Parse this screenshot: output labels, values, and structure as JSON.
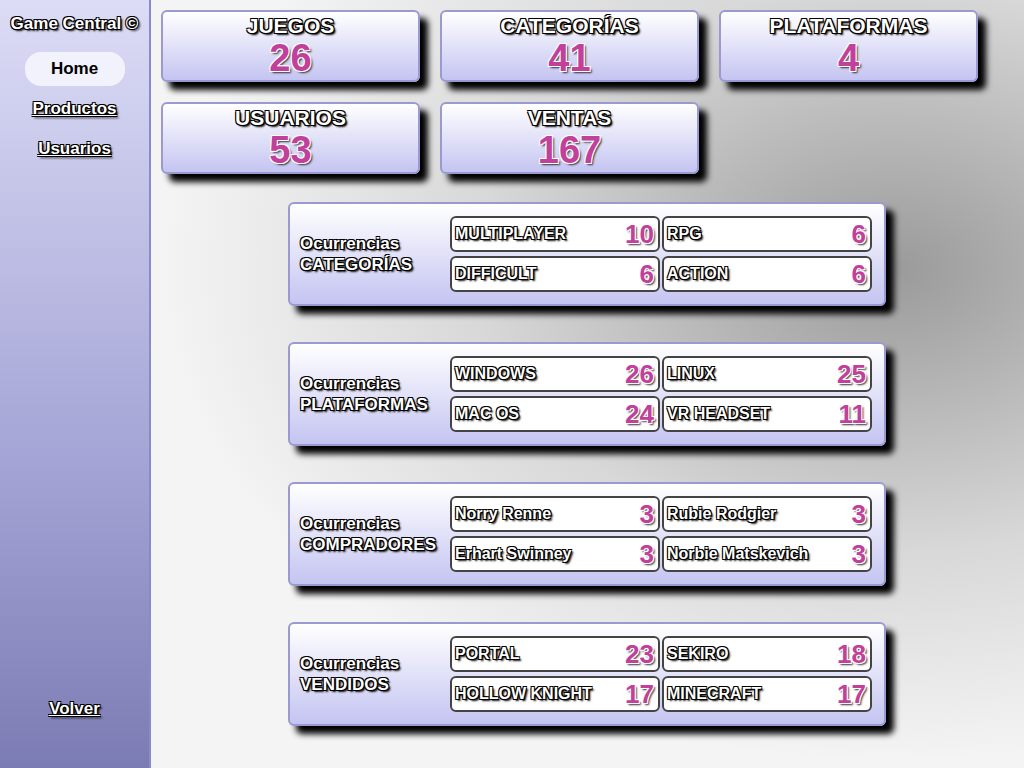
{
  "sidebar": {
    "brand": "Game Central ©",
    "items": [
      {
        "label": "Home",
        "selected": true
      },
      {
        "label": "Productos",
        "selected": false
      },
      {
        "label": "Usuarios",
        "selected": false
      }
    ],
    "back": "Volver"
  },
  "stats": [
    {
      "label": "JUEGOS",
      "value": "26"
    },
    {
      "label": "CATEGORÍAS",
      "value": "41"
    },
    {
      "label": "PLATAFORMAS",
      "value": "4"
    },
    {
      "label": "USUARIOS",
      "value": "53"
    },
    {
      "label": "VENTAS",
      "value": "167"
    }
  ],
  "panels": [
    {
      "label": "Ocurrencias",
      "subject": "CATEGORÍAS",
      "items": [
        {
          "name": "MULTIPLAYER",
          "count": "10"
        },
        {
          "name": "RPG",
          "count": "6"
        },
        {
          "name": "DIFFICULT",
          "count": "6"
        },
        {
          "name": "ACTION",
          "count": "6"
        }
      ]
    },
    {
      "label": "Ocurrencias",
      "subject": "PLATAFORMAS",
      "items": [
        {
          "name": "WINDOWS",
          "count": "26"
        },
        {
          "name": "LINUX",
          "count": "25"
        },
        {
          "name": "MAC OS",
          "count": "24"
        },
        {
          "name": "VR HEADSET",
          "count": "11"
        }
      ]
    },
    {
      "label": "Ocurrencias",
      "subject": "COMPRADORES",
      "items": [
        {
          "name": "Norry Renne",
          "count": "3"
        },
        {
          "name": "Rubie Rodgier",
          "count": "3"
        },
        {
          "name": "Erhart Swinney",
          "count": "3"
        },
        {
          "name": "Norbie Matskevich",
          "count": "3"
        }
      ]
    },
    {
      "label": "Ocurrencias",
      "subject": "VENDIDOS",
      "items": [
        {
          "name": "PORTAL",
          "count": "23"
        },
        {
          "name": "SEKIRO",
          "count": "18"
        },
        {
          "name": "HOLLOW KNIGHT",
          "count": "17"
        },
        {
          "name": "MINECRAFT",
          "count": "17"
        }
      ]
    }
  ]
}
